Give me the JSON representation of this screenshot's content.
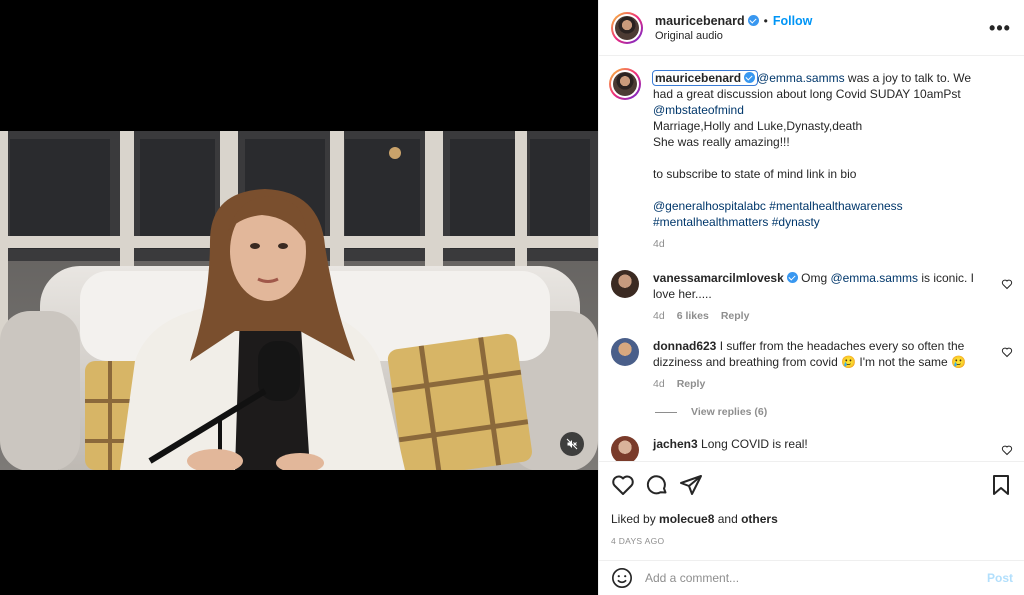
{
  "header": {
    "username": "mauricebenard",
    "separator": "•",
    "follow_label": "Follow",
    "audio_label": "Original audio",
    "more_label": "•••"
  },
  "caption": {
    "username": "mauricebenard",
    "mention": "@emma.samms",
    "line1_rest": " was a joy to talk to. We had a great discussion about long Covid SUDAY 10amPst",
    "mention2": "@mbstateofmind",
    "line2": "Marriage,Holly and Luke,Dynasty,death",
    "line3": "She was really amazing!!!",
    "line4": "to subscribe to state of mind link in bio",
    "tag1": "@generalhospitalabc",
    "tag2": "#mentalhealthawareness",
    "tag3": "#mentalhealthmatters",
    "tag4": "#dynasty",
    "time": "4d"
  },
  "comments": [
    {
      "username": "vanessamarcilmlovesk",
      "verified": true,
      "pre": "Omg ",
      "mention": "@emma.samms",
      "post": " is iconic. I love her.....",
      "time": "4d",
      "likes": "6 likes",
      "reply": "Reply"
    },
    {
      "username": "donnad623",
      "verified": false,
      "text": "I suffer from the headaches every so often the dizziness and breathing from covid 🥲 I'm not the same 🥲",
      "time": "4d",
      "reply": "Reply",
      "view_replies": "View replies (6)"
    },
    {
      "username": "jachen3",
      "verified": false,
      "text": "Long COVID is real!"
    }
  ],
  "likes": {
    "prefix": "Liked by ",
    "user": "molecue8",
    "middle": " and ",
    "others": "others"
  },
  "date": "4 DAYS AGO",
  "add_comment": {
    "placeholder": "Add a comment...",
    "post_label": "Post"
  },
  "colors": {
    "accent": "#0095f6",
    "link": "#00376b",
    "muted": "#8e8e8e",
    "verified": "#3897f0"
  },
  "icons": [
    "mute-icon",
    "heart-icon",
    "comment-icon",
    "share-icon",
    "bookmark-icon",
    "emoji-icon",
    "more-icon",
    "verified-icon"
  ]
}
